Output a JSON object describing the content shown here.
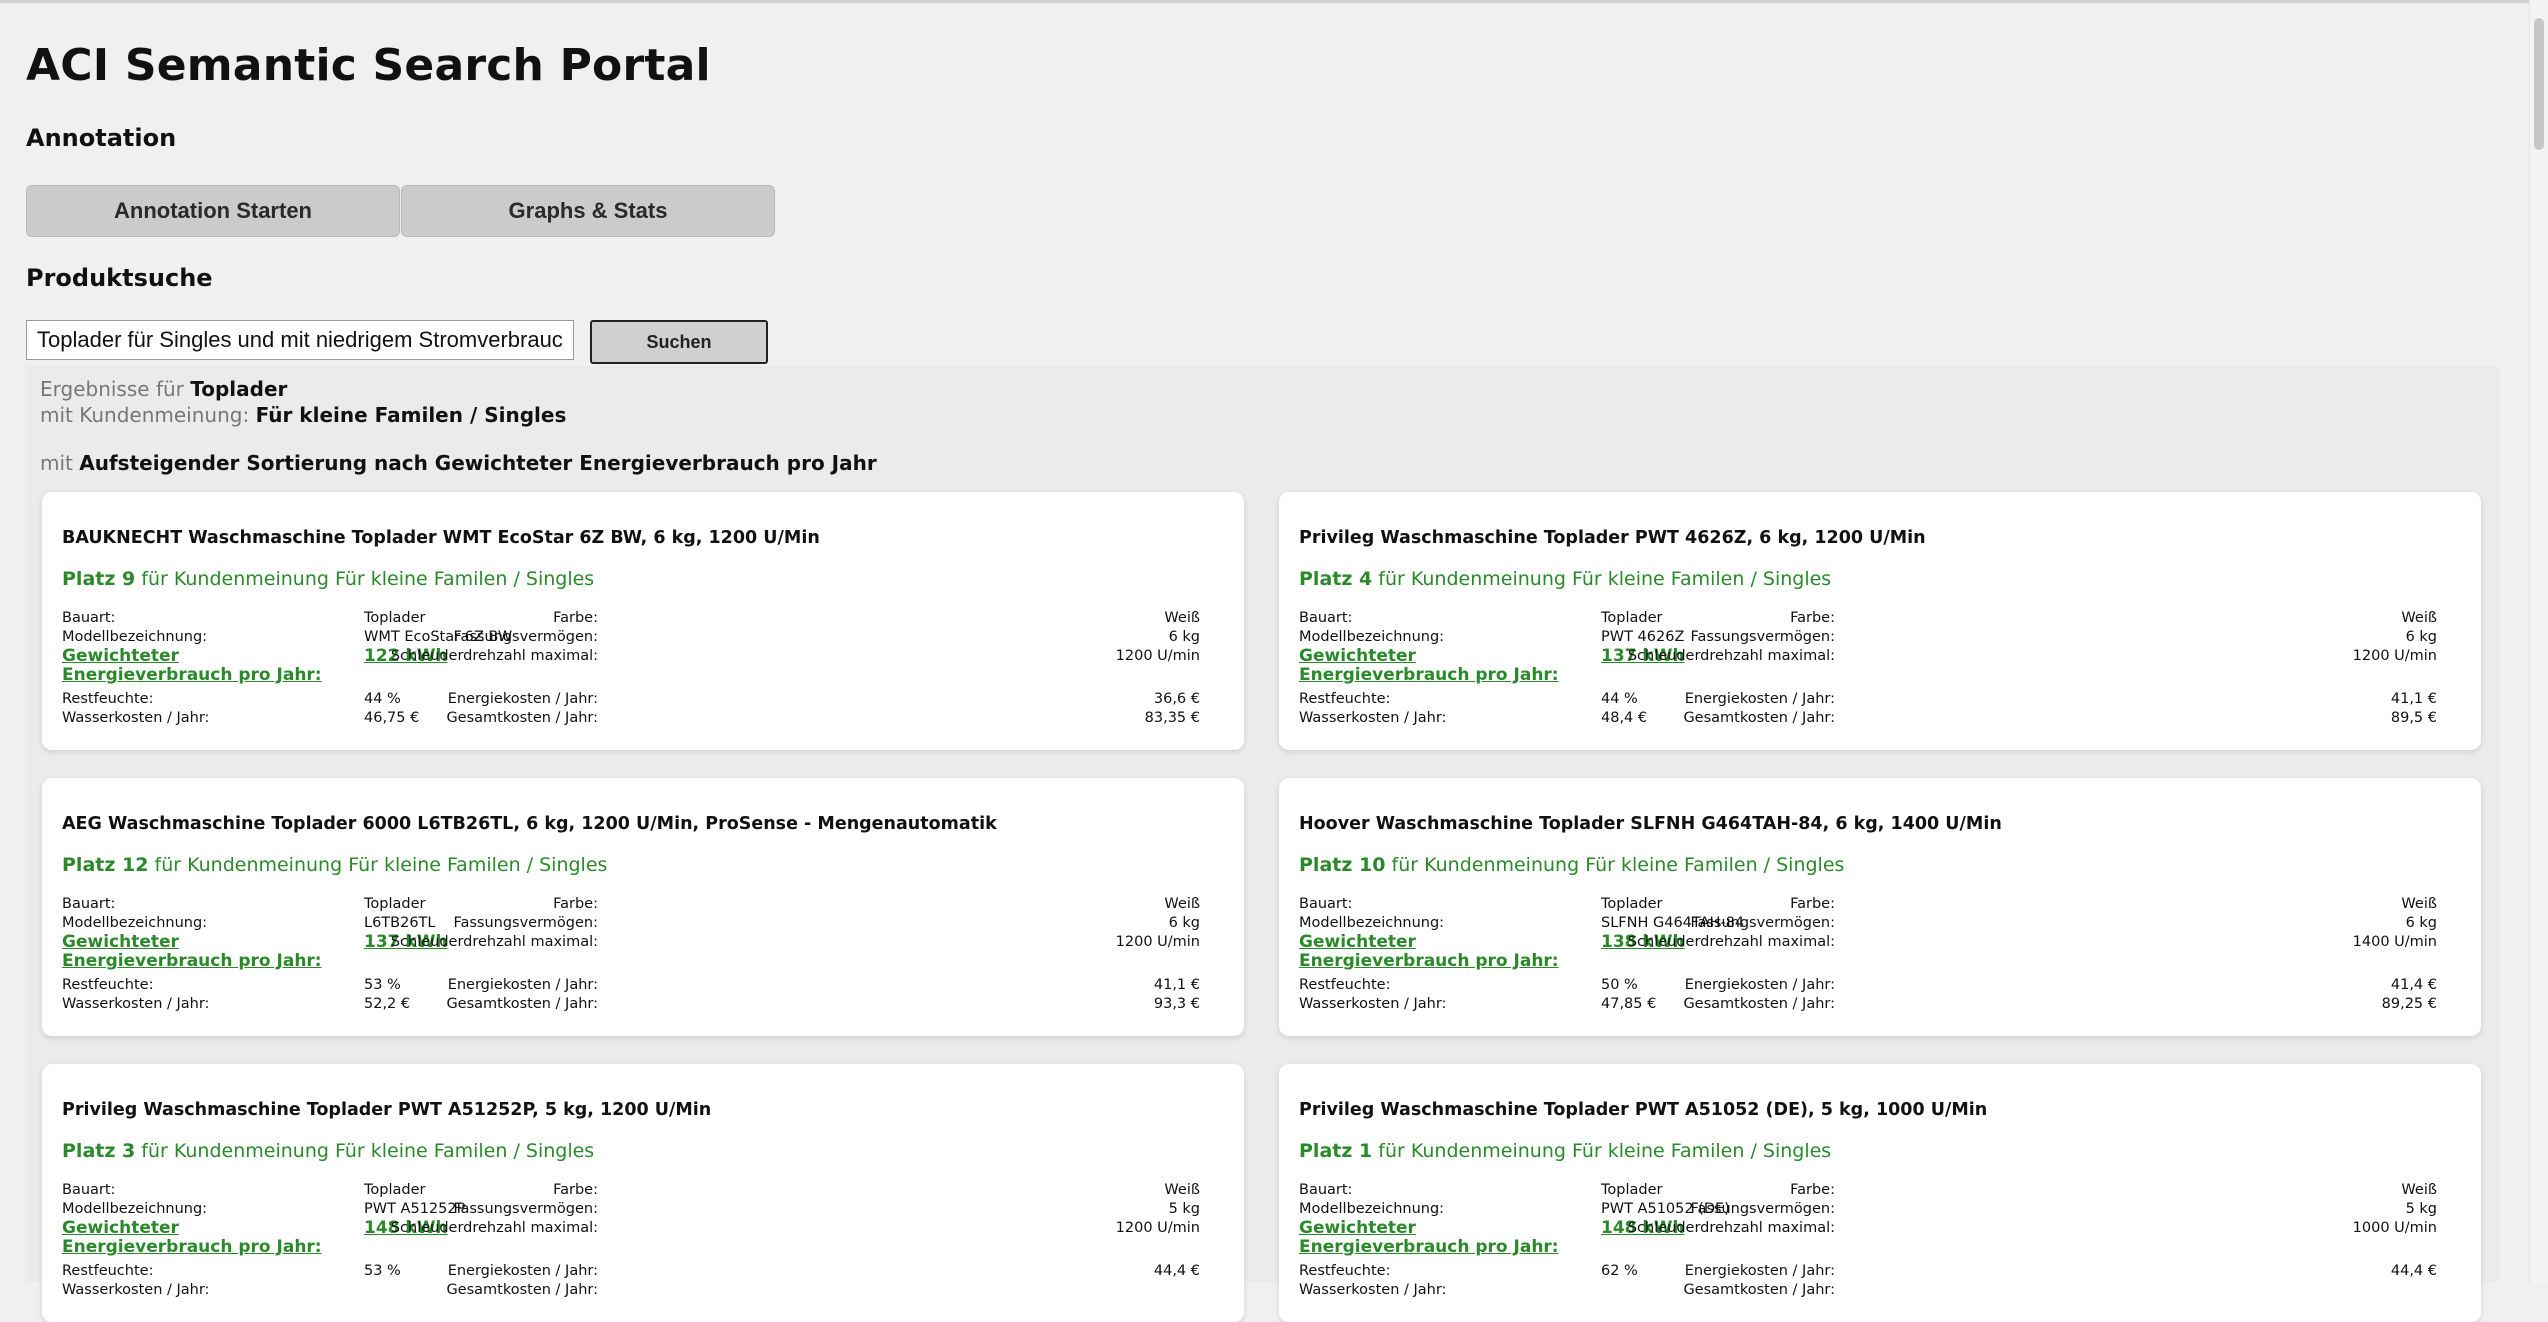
{
  "app": {
    "title": "ACI Semantic Search Portal"
  },
  "annotation": {
    "heading": "Annotation",
    "tabs": [
      {
        "label": "Annotation Starten"
      },
      {
        "label": "Graphs & Stats"
      }
    ]
  },
  "search": {
    "heading": "Produktsuche",
    "query": "Toplader für Singles und mit niedrigem Stromverbrauch",
    "button_label": "Suchen"
  },
  "summary": {
    "results_prefix": "Ergebnisse für",
    "results_term": "Toplader",
    "opinion_prefix": "mit Kundenmeinung:",
    "opinion_term": "Für kleine Familen / Singles",
    "sort_prefix": "mit",
    "sort_term": "Aufsteigender Sortierung nach Gewichteter Energieverbrauch pro Jahr"
  },
  "labels": {
    "bauart": "Bauart:",
    "modell": "Modellbezeichnung:",
    "energie": "Gewichteter Energieverbrauch pro Jahr:",
    "restfeuchte": "Restfeuchte:",
    "wasserkosten": "Wasserkosten / Jahr:",
    "farbe": "Farbe:",
    "fassung": "Fassungsvermögen:",
    "schleuder": "Schleuderdrehzahl maximal:",
    "energiekosten": "Energiekosten / Jahr:",
    "gesamtkosten": "Gesamtkosten / Jahr:",
    "rank_suffix": "für Kundenmeinung Für kleine Familen / Singles"
  },
  "cards": [
    {
      "title": "BAUKNECHT Waschmaschine Toplader WMT EcoStar 6Z BW, 6 kg, 1200 U/Min",
      "rank": "Platz 9",
      "bauart": "Toplader",
      "modell": "WMT EcoStar 6Z BW",
      "energie": "122 kWh",
      "restfeuchte": "44 %",
      "wasserkosten": "46,75 €",
      "farbe": "Weiß",
      "fassung": "6 kg",
      "schleuder": "1200 U/min",
      "energiekosten": "36,6 €",
      "gesamtkosten": "83,35 €"
    },
    {
      "title": "Privileg Waschmaschine Toplader PWT 4626Z, 6 kg, 1200 U/Min",
      "rank": "Platz 4",
      "bauart": "Toplader",
      "modell": "PWT 4626Z",
      "energie": "137 kWh",
      "restfeuchte": "44 %",
      "wasserkosten": "48,4 €",
      "farbe": "Weiß",
      "fassung": "6 kg",
      "schleuder": "1200 U/min",
      "energiekosten": "41,1 €",
      "gesamtkosten": "89,5 €"
    },
    {
      "title": "AEG Waschmaschine Toplader 6000 L6TB26TL, 6 kg, 1200 U/Min, ProSense - Mengenautomatik",
      "rank": "Platz 12",
      "bauart": "Toplader",
      "modell": "L6TB26TL",
      "energie": "137 kWh",
      "restfeuchte": "53 %",
      "wasserkosten": "52,2 €",
      "farbe": "Weiß",
      "fassung": "6 kg",
      "schleuder": "1200 U/min",
      "energiekosten": "41,1 €",
      "gesamtkosten": "93,3 €"
    },
    {
      "title": "Hoover Waschmaschine Toplader SLFNH G464TAH-84, 6 kg, 1400 U/Min",
      "rank": "Platz 10",
      "bauart": "Toplader",
      "modell": "SLFNH G464TAH-84",
      "energie": "138 kWh",
      "restfeuchte": "50 %",
      "wasserkosten": "47,85 €",
      "farbe": "Weiß",
      "fassung": "6 kg",
      "schleuder": "1400 U/min",
      "energiekosten": "41,4 €",
      "gesamtkosten": "89,25 €"
    },
    {
      "title": "Privileg Waschmaschine Toplader PWT A51252P, 5 kg, 1200 U/Min",
      "rank": "Platz 3",
      "bauart": "Toplader",
      "modell": "PWT A51252P",
      "energie": "148 kWh",
      "restfeuchte": "53 %",
      "wasserkosten": "",
      "farbe": "Weiß",
      "fassung": "5 kg",
      "schleuder": "1200 U/min",
      "energiekosten": "44,4 €",
      "gesamtkosten": ""
    },
    {
      "title": "Privileg Waschmaschine Toplader PWT A51052 (DE), 5 kg, 1000 U/Min",
      "rank": "Platz 1",
      "bauart": "Toplader",
      "modell": "PWT A51052 (DE)",
      "energie": "148 kWh",
      "restfeuchte": "62 %",
      "wasserkosten": "",
      "farbe": "Weiß",
      "fassung": "5 kg",
      "schleuder": "1000 U/min",
      "energiekosten": "44,4 €",
      "gesamtkosten": ""
    }
  ]
}
